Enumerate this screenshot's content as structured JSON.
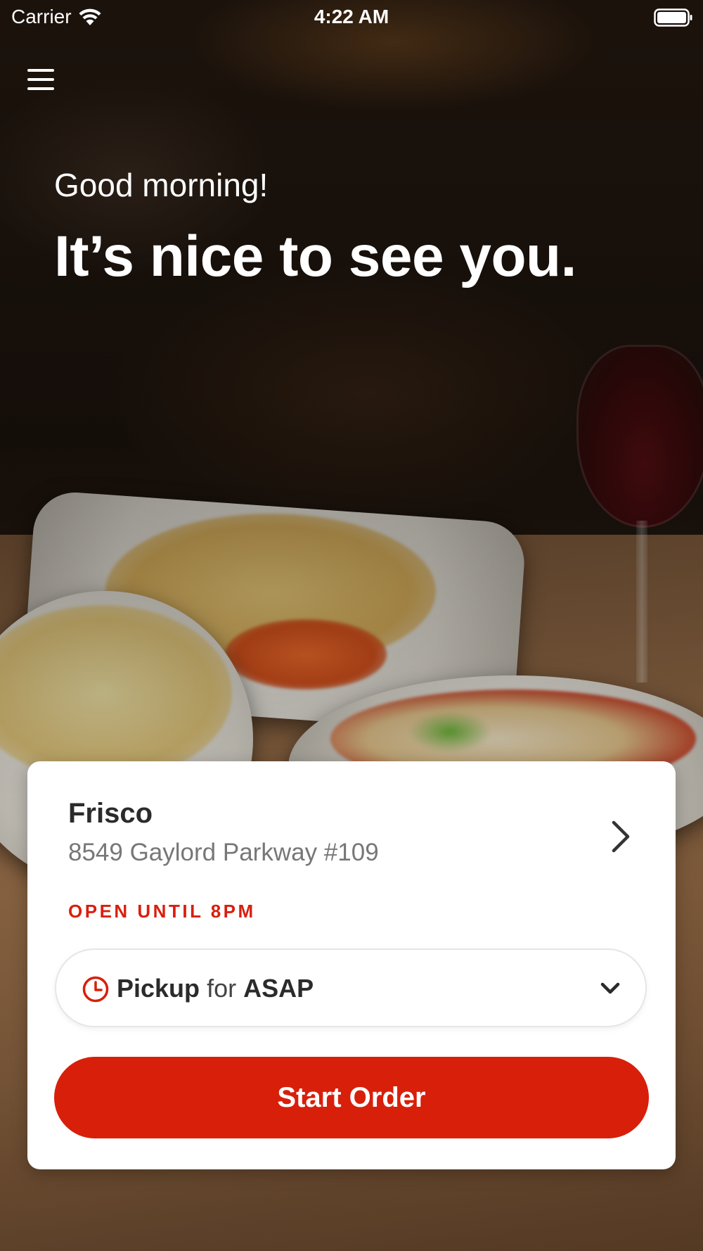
{
  "status_bar": {
    "carrier": "Carrier",
    "time": "4:22 AM",
    "wifi_icon": "wifi-icon",
    "battery_icon": "battery-icon"
  },
  "menu": {
    "icon": "hamburger-menu-icon"
  },
  "greeting": {
    "subtitle": "Good morning!",
    "title": "It’s nice to see you."
  },
  "location_card": {
    "store_name": "Frisco",
    "address": "8549 Gaylord Parkway #109",
    "hours_status": "OPEN UNTIL 8PM",
    "chevron_icon": "chevron-right-icon"
  },
  "pickup_selector": {
    "icon": "clock-icon",
    "mode": "Pickup",
    "connector": "for",
    "time": "ASAP",
    "dropdown_icon": "chevron-down-icon"
  },
  "start_order": {
    "label": "Start Order"
  },
  "colors": {
    "accent": "#d81f0a",
    "hours_text": "#d81f0f",
    "card_background": "#ffffff",
    "text_primary": "#2b2b2b",
    "text_secondary": "#777777"
  }
}
